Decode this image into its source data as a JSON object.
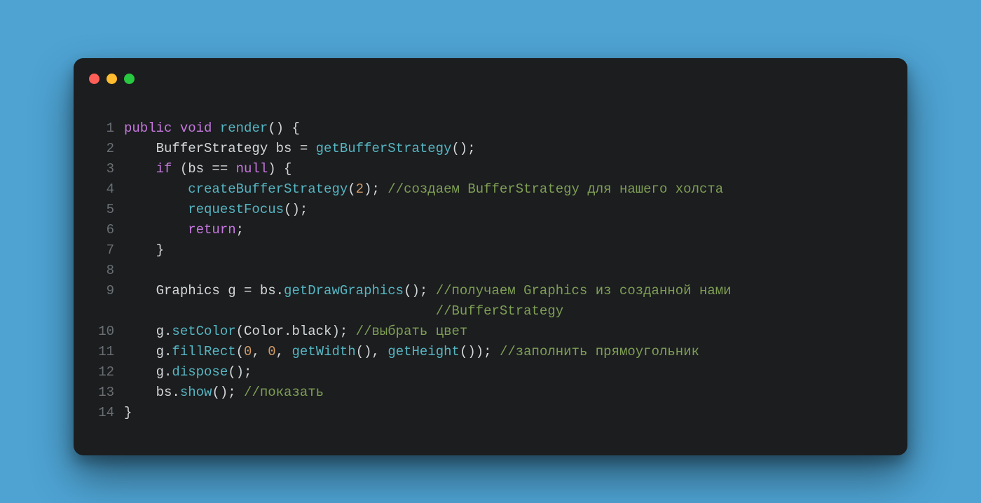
{
  "colors": {
    "page_bg": "#4ea3d3",
    "card_bg": "#1b1d1f",
    "traffic_red": "#ff5f57",
    "traffic_yellow": "#febc2e",
    "traffic_green": "#28c840",
    "line_number": "#6a6f73",
    "kw": "#c678dd",
    "fn": "#56b6c2",
    "num": "#d19a66",
    "com": "#7f9f54",
    "plain": "#d4d7d9"
  },
  "code": [
    {
      "n": "1",
      "tokens": [
        {
          "c": "kw",
          "t": "public"
        },
        {
          "c": "plain",
          "t": " "
        },
        {
          "c": "kw",
          "t": "void"
        },
        {
          "c": "plain",
          "t": " "
        },
        {
          "c": "fn",
          "t": "render"
        },
        {
          "c": "plain",
          "t": "() {"
        }
      ]
    },
    {
      "n": "2",
      "tokens": [
        {
          "c": "plain",
          "t": "    BufferStrategy bs = "
        },
        {
          "c": "fn",
          "t": "getBufferStrategy"
        },
        {
          "c": "plain",
          "t": "();"
        }
      ]
    },
    {
      "n": "3",
      "tokens": [
        {
          "c": "plain",
          "t": "    "
        },
        {
          "c": "kw",
          "t": "if"
        },
        {
          "c": "plain",
          "t": " (bs == "
        },
        {
          "c": "kw",
          "t": "null"
        },
        {
          "c": "plain",
          "t": ") {"
        }
      ]
    },
    {
      "n": "4",
      "tokens": [
        {
          "c": "plain",
          "t": "        "
        },
        {
          "c": "fn",
          "t": "createBufferStrategy"
        },
        {
          "c": "plain",
          "t": "("
        },
        {
          "c": "num",
          "t": "2"
        },
        {
          "c": "plain",
          "t": "); "
        },
        {
          "c": "com",
          "t": "//создаем BufferStrategy для нашего холста"
        }
      ]
    },
    {
      "n": "5",
      "tokens": [
        {
          "c": "plain",
          "t": "        "
        },
        {
          "c": "fn",
          "t": "requestFocus"
        },
        {
          "c": "plain",
          "t": "();"
        }
      ]
    },
    {
      "n": "6",
      "tokens": [
        {
          "c": "plain",
          "t": "        "
        },
        {
          "c": "kw",
          "t": "return"
        },
        {
          "c": "plain",
          "t": ";"
        }
      ]
    },
    {
      "n": "7",
      "tokens": [
        {
          "c": "plain",
          "t": "    }"
        }
      ]
    },
    {
      "n": "8",
      "tokens": [
        {
          "c": "plain",
          "t": ""
        }
      ]
    },
    {
      "n": "9",
      "tokens": [
        {
          "c": "plain",
          "t": "    Graphics g = bs."
        },
        {
          "c": "fn",
          "t": "getDrawGraphics"
        },
        {
          "c": "plain",
          "t": "(); "
        },
        {
          "c": "com",
          "t": "//получаем Graphics из созданной нами"
        }
      ]
    },
    {
      "n": "",
      "tokens": [
        {
          "c": "plain",
          "t": "                                       "
        },
        {
          "c": "com",
          "t": "//BufferStrategy"
        }
      ]
    },
    {
      "n": "10",
      "tokens": [
        {
          "c": "plain",
          "t": "    g."
        },
        {
          "c": "fn",
          "t": "setColor"
        },
        {
          "c": "plain",
          "t": "(Color.black); "
        },
        {
          "c": "com",
          "t": "//выбрать цвет"
        }
      ]
    },
    {
      "n": "11",
      "tokens": [
        {
          "c": "plain",
          "t": "    g."
        },
        {
          "c": "fn",
          "t": "fillRect"
        },
        {
          "c": "plain",
          "t": "("
        },
        {
          "c": "num",
          "t": "0"
        },
        {
          "c": "plain",
          "t": ", "
        },
        {
          "c": "num",
          "t": "0"
        },
        {
          "c": "plain",
          "t": ", "
        },
        {
          "c": "fn",
          "t": "getWidth"
        },
        {
          "c": "plain",
          "t": "(), "
        },
        {
          "c": "fn",
          "t": "getHeight"
        },
        {
          "c": "plain",
          "t": "()); "
        },
        {
          "c": "com",
          "t": "//заполнить прямоугольник"
        }
      ]
    },
    {
      "n": "12",
      "tokens": [
        {
          "c": "plain",
          "t": "    g."
        },
        {
          "c": "fn",
          "t": "dispose"
        },
        {
          "c": "plain",
          "t": "();"
        }
      ]
    },
    {
      "n": "13",
      "tokens": [
        {
          "c": "plain",
          "t": "    bs."
        },
        {
          "c": "fn",
          "t": "show"
        },
        {
          "c": "plain",
          "t": "(); "
        },
        {
          "c": "com",
          "t": "//показать"
        }
      ]
    },
    {
      "n": "14",
      "tokens": [
        {
          "c": "plain",
          "t": "}"
        }
      ]
    }
  ]
}
